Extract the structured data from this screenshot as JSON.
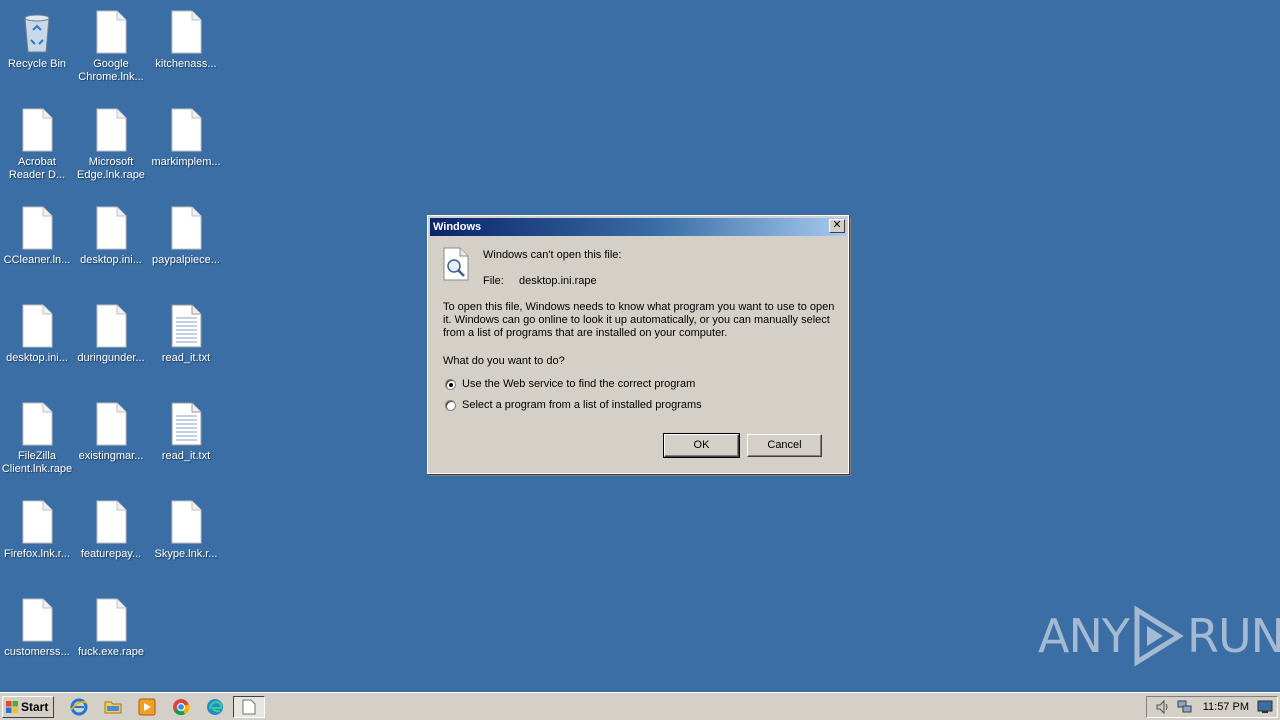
{
  "desktop": {
    "icons": [
      {
        "label": "Recycle Bin",
        "type": "recycle"
      },
      {
        "label": "Google Chrome.lnk...",
        "type": "file"
      },
      {
        "label": "kitchenass...",
        "type": "file"
      },
      {
        "label": "Acrobat Reader D...",
        "type": "file"
      },
      {
        "label": "Microsoft Edge.lnk.rape",
        "type": "file"
      },
      {
        "label": "markimplem...",
        "type": "file"
      },
      {
        "label": "CCleaner.ln...",
        "type": "file"
      },
      {
        "label": "desktop.ini...",
        "type": "file"
      },
      {
        "label": "paypalpiece...",
        "type": "file"
      },
      {
        "label": "desktop.ini...",
        "type": "file"
      },
      {
        "label": "duringunder...",
        "type": "file"
      },
      {
        "label": "read_it.txt",
        "type": "text"
      },
      {
        "label": "FileZilla Client.lnk.rape",
        "type": "file"
      },
      {
        "label": "existingmar...",
        "type": "file"
      },
      {
        "label": "read_it.txt",
        "type": "text"
      },
      {
        "label": "Firefox.lnk.r...",
        "type": "file"
      },
      {
        "label": "featurepay...",
        "type": "file"
      },
      {
        "label": "Skype.lnk.r...",
        "type": "file"
      },
      {
        "label": "customerss...",
        "type": "file"
      },
      {
        "label": "fuck.exe.rape",
        "type": "file"
      }
    ]
  },
  "dialog": {
    "title": "Windows",
    "close_label": "✕",
    "cant_open": "Windows can't open this file:",
    "file_label": "File:",
    "file_name": "desktop.ini.rape",
    "description": "To open this file, Windows needs to know what program you want to use to open it. Windows can go online to look it up automatically, or you can manually select from a list of programs that are installed on your computer.",
    "question": "What do you want to do?",
    "options": [
      {
        "label": "Use the Web service to find the correct program",
        "checked": true
      },
      {
        "label": "Select a program from a list of installed programs",
        "checked": false
      }
    ],
    "ok_label": "OK",
    "cancel_label": "Cancel"
  },
  "taskbar": {
    "start_label": "Start",
    "quick_launch": [
      "ie-icon",
      "folder-icon",
      "media-player-icon",
      "chrome-icon",
      "edge-icon"
    ],
    "clock": "11:57 PM"
  },
  "watermark": {
    "left": "ANY",
    "right": "RUN"
  }
}
